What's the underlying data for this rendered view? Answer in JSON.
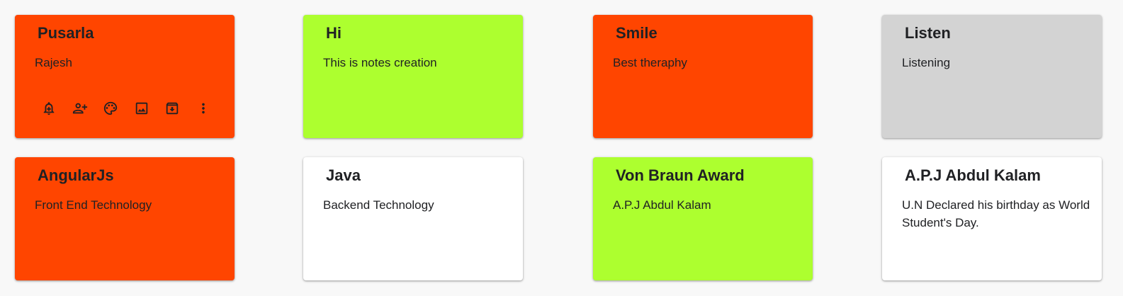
{
  "colors": {
    "page_background": "#f8f8f8",
    "orange_red": "#ff4500",
    "green_yellow": "#adff2f",
    "light_gray": "#d3d3d3",
    "white": "#ffffff"
  },
  "notes": [
    {
      "title": "Pusarla",
      "body": "Rajesh",
      "color": "#ff4500"
    },
    {
      "title": "Hi",
      "body": "This is notes creation",
      "color": "#adff2f"
    },
    {
      "title": "Smile",
      "body": "Best theraphy",
      "color": "#ff4500"
    },
    {
      "title": "Listen",
      "body": "Listening",
      "color": "#d3d3d3"
    },
    {
      "title": "AngularJs",
      "body": "Front End Technology",
      "color": "#ff4500"
    },
    {
      "title": "Java",
      "body": "Backend Technology",
      "color": "#ffffff"
    },
    {
      "title": "Von Braun Award",
      "body": "A.P.J Abdul Kalam",
      "color": "#adff2f"
    },
    {
      "title": "A.P.J Abdul Kalam",
      "body": "U.N Declared his birthday as World Student's Day.",
      "color": "#ffffff"
    }
  ],
  "toolbar_icons": [
    "add-reminder-icon",
    "add-collaborator-icon",
    "palette-icon",
    "add-image-icon",
    "archive-icon",
    "more-options-icon"
  ]
}
